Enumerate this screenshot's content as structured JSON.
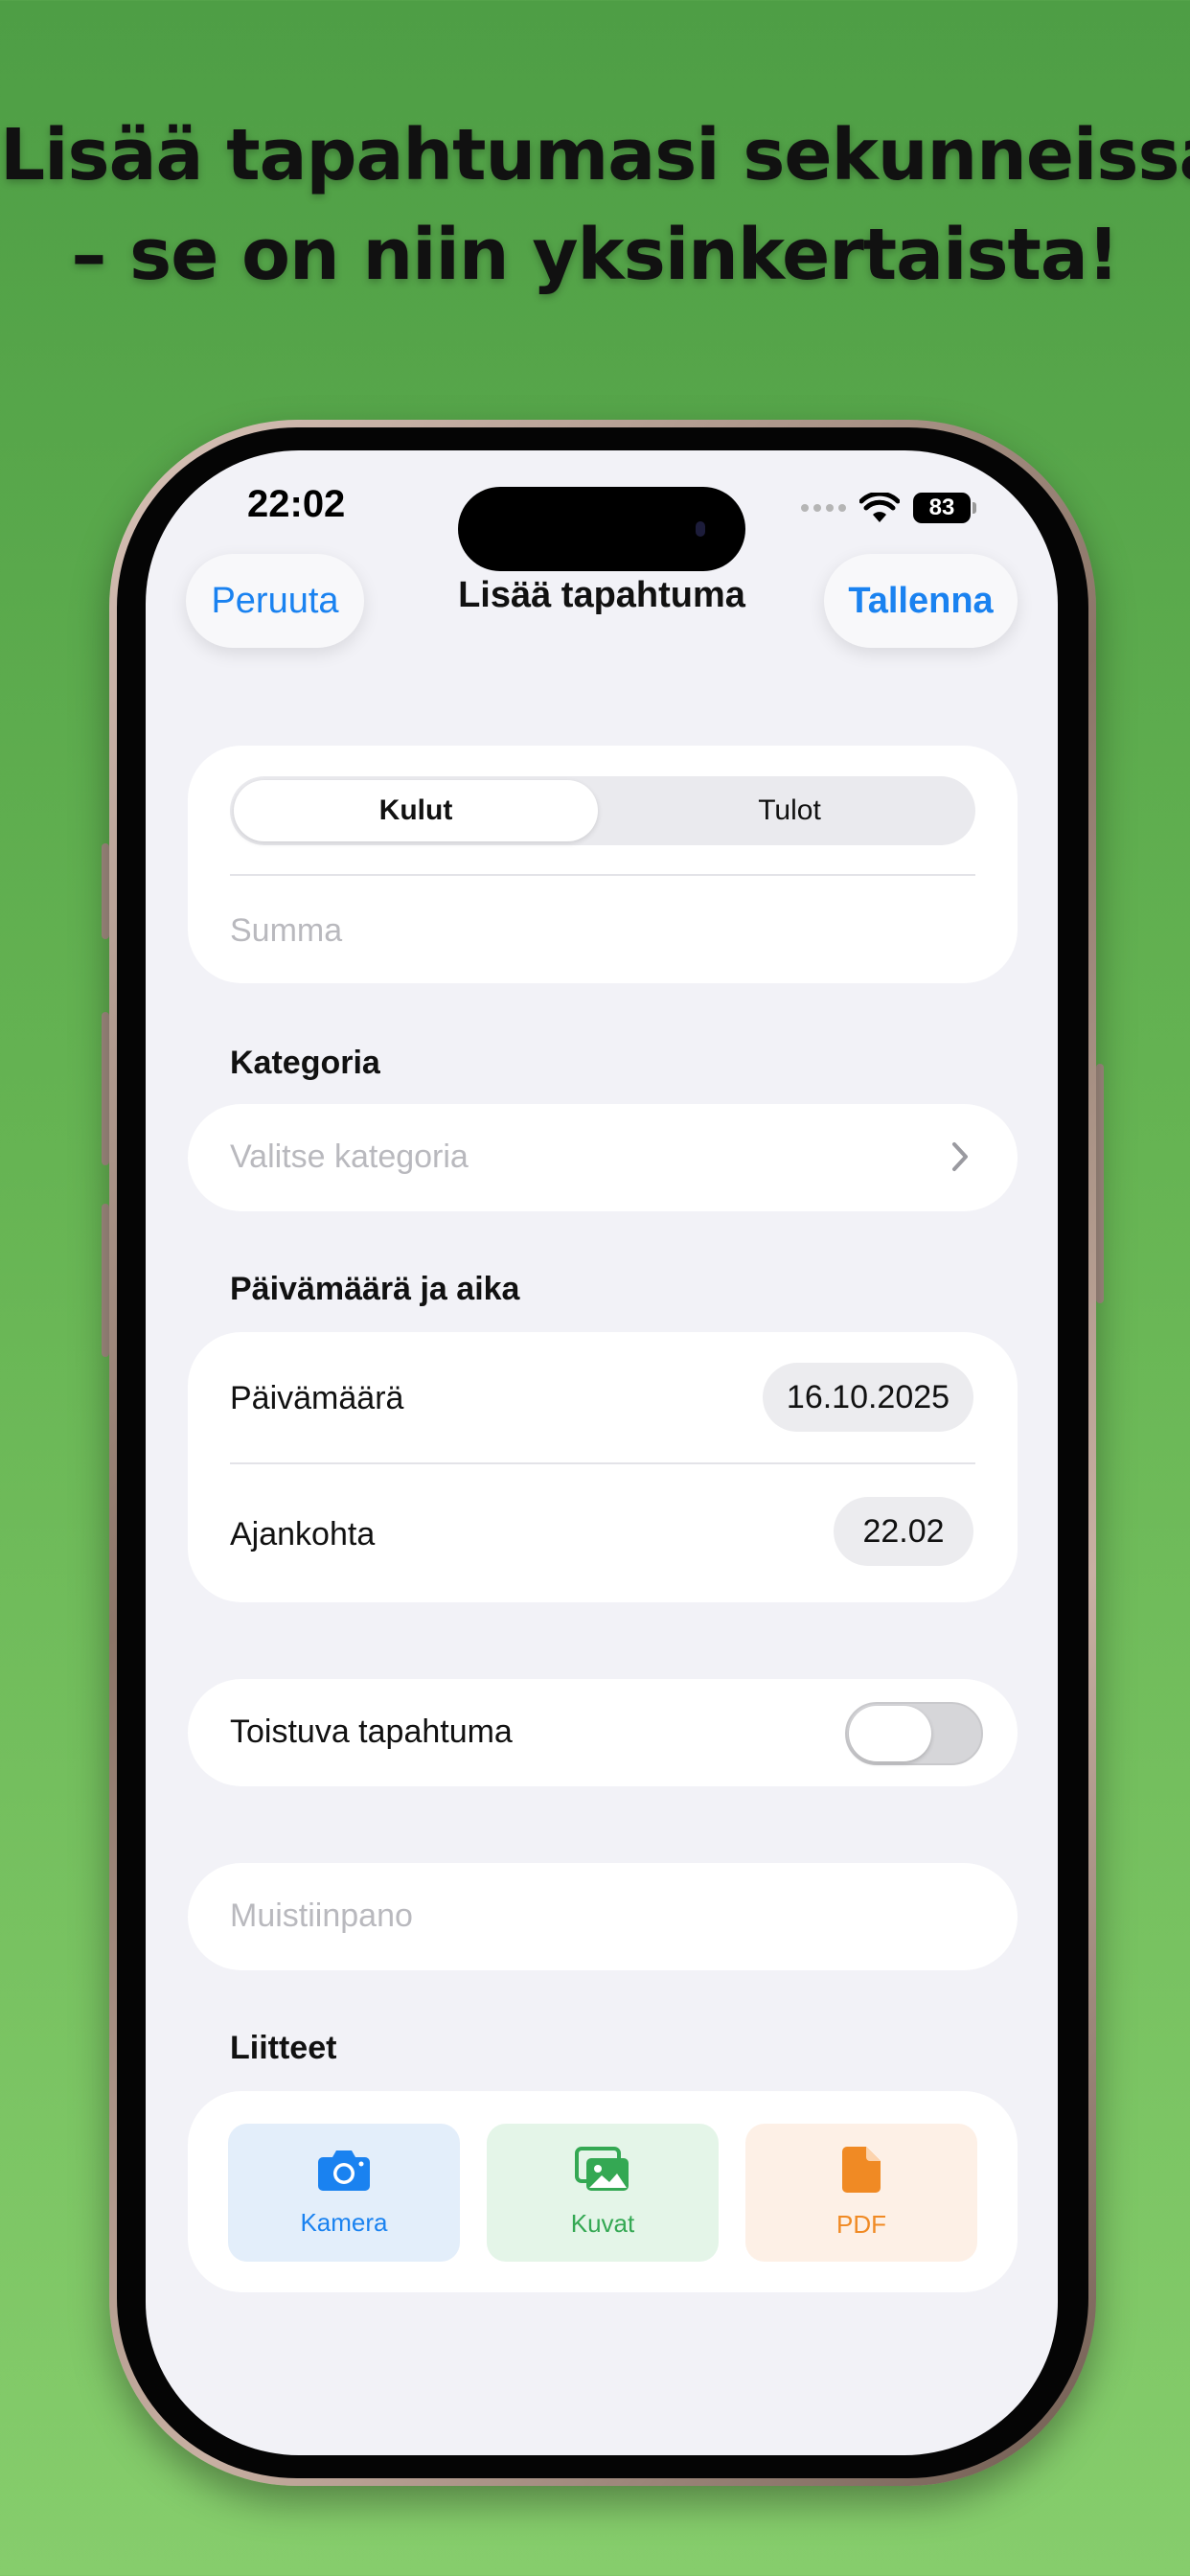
{
  "headline": {
    "line1": "Lisää tapahtumasi sekunneissa",
    "line2": "– se on niin yksinkertaista!"
  },
  "status_bar": {
    "time": "22:02",
    "battery": "83"
  },
  "nav": {
    "cancel_label": "Peruuta",
    "title": "Lisää tapahtuma",
    "save_label": "Tallenna"
  },
  "type_segment": {
    "options": [
      "Kulut",
      "Tulot"
    ],
    "selected": "Kulut"
  },
  "amount": {
    "placeholder": "Summa"
  },
  "category": {
    "section_label": "Kategoria",
    "placeholder": "Valitse kategoria"
  },
  "datetime": {
    "section_label": "Päivämäärä ja aika",
    "date_label": "Päivämäärä",
    "date_value": "16.10.2025",
    "time_label": "Ajankohta",
    "time_value": "22.02"
  },
  "recurring": {
    "label": "Toistuva tapahtuma",
    "enabled": false
  },
  "note": {
    "placeholder": "Muistiinpano"
  },
  "attachments": {
    "section_label": "Liitteet",
    "items": [
      {
        "label": "Kamera",
        "icon": "camera-icon",
        "color": "#1a82f0"
      },
      {
        "label": "Kuvat",
        "icon": "photos-icon",
        "color": "#34a853"
      },
      {
        "label": "PDF",
        "icon": "document-icon",
        "color": "#f08a24"
      }
    ]
  },
  "colors": {
    "accent": "#1a82f0",
    "background": "#4e9e45"
  }
}
